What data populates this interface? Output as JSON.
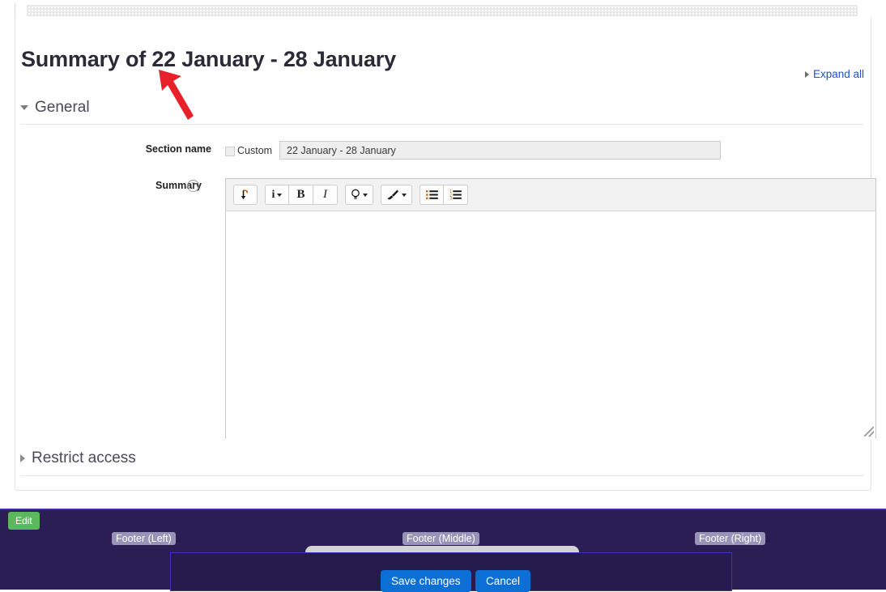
{
  "page": {
    "title": "Summary of 22 January - 28 January",
    "expand_all": "Expand all"
  },
  "sections": {
    "general": {
      "legend": "General",
      "caret_icon": "caret-down-icon"
    },
    "restrict_access": {
      "legend": "Restrict access",
      "caret_icon": "caret-right-icon"
    }
  },
  "form": {
    "section_name": {
      "label": "Section name",
      "custom_checkbox_label": "Custom",
      "custom_checked": false,
      "value": "22 January - 28 January",
      "placeholder": "22 January - 28 January"
    },
    "summary": {
      "label": "Summary",
      "help_icon": "question-mark-help-icon",
      "help_glyph": "?",
      "content": ""
    }
  },
  "editor_toolbar": {
    "groups": [
      {
        "buttons": [
          {
            "name": "undo-button",
            "icon": "undo-arrow-icon",
            "has_caret": false
          }
        ]
      },
      {
        "buttons": [
          {
            "name": "paragraph-style-button",
            "icon": "info-i-icon",
            "glyph": "i",
            "has_caret": true
          },
          {
            "name": "bold-button",
            "icon": "bold-icon",
            "glyph": "B",
            "has_caret": false
          },
          {
            "name": "italic-button",
            "icon": "italic-icon",
            "glyph": "I",
            "has_caret": false
          }
        ]
      },
      {
        "buttons": [
          {
            "name": "insert-button",
            "icon": "lightbulb-icon",
            "has_caret": true
          }
        ]
      },
      {
        "buttons": [
          {
            "name": "format-brush-button",
            "icon": "paintbrush-icon",
            "has_caret": true
          }
        ]
      },
      {
        "buttons": [
          {
            "name": "bulleted-list-button",
            "icon": "bulleted-list-icon",
            "has_caret": false
          },
          {
            "name": "numbered-list-button",
            "icon": "numbered-list-icon",
            "has_caret": false
          }
        ]
      }
    ]
  },
  "annotation": {
    "arrow_color": "#e8202a",
    "arrow_name": "red-pointer-arrow"
  },
  "footer": {
    "edit_label": "Edit",
    "region_left": "Footer (Left)",
    "region_middle": "Footer (Middle)",
    "region_right": "Footer (Right)",
    "save_label": "Save changes",
    "cancel_label": "Cancel",
    "background_color": "#2b1e55",
    "edit_button_color": "#5cb85c",
    "primary_button_color": "#0b6fd6"
  }
}
